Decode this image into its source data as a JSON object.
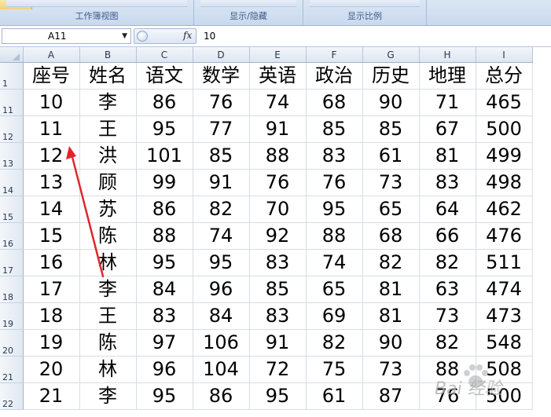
{
  "ribbon": {
    "groups": [
      {
        "label": "工作簿视图"
      },
      {
        "label": "显示/隐藏"
      },
      {
        "label": "显示比例"
      }
    ]
  },
  "formula_bar": {
    "name_box": "A11",
    "fx_icon": "fx",
    "value": "10"
  },
  "grid": {
    "columns": [
      "A",
      "B",
      "C",
      "D",
      "E",
      "F",
      "G",
      "H",
      "I"
    ],
    "header_row": {
      "row": "1",
      "cells": [
        "座号",
        "姓名",
        "语文",
        "数学",
        "英语",
        "政治",
        "历史",
        "地理",
        "总分"
      ]
    },
    "rows": [
      {
        "row": "11",
        "cells": [
          "10",
          "李",
          "86",
          "76",
          "74",
          "68",
          "90",
          "71",
          "465"
        ]
      },
      {
        "row": "12",
        "cells": [
          "11",
          "王",
          "95",
          "77",
          "91",
          "85",
          "85",
          "67",
          "500"
        ]
      },
      {
        "row": "13",
        "cells": [
          "12",
          "洪",
          "101",
          "85",
          "88",
          "83",
          "61",
          "81",
          "499"
        ]
      },
      {
        "row": "14",
        "cells": [
          "13",
          "顾",
          "99",
          "91",
          "76",
          "76",
          "73",
          "83",
          "498"
        ]
      },
      {
        "row": "15",
        "cells": [
          "14",
          "苏",
          "86",
          "82",
          "70",
          "95",
          "65",
          "64",
          "462"
        ]
      },
      {
        "row": "16",
        "cells": [
          "15",
          "陈",
          "88",
          "74",
          "92",
          "88",
          "68",
          "66",
          "476"
        ]
      },
      {
        "row": "17",
        "cells": [
          "16",
          "林",
          "95",
          "95",
          "83",
          "74",
          "82",
          "82",
          "511"
        ]
      },
      {
        "row": "18",
        "cells": [
          "17",
          "李",
          "84",
          "96",
          "85",
          "65",
          "81",
          "63",
          "474"
        ]
      },
      {
        "row": "19",
        "cells": [
          "18",
          "王",
          "83",
          "84",
          "83",
          "69",
          "81",
          "73",
          "473"
        ]
      },
      {
        "row": "20",
        "cells": [
          "19",
          "陈",
          "97",
          "106",
          "91",
          "82",
          "90",
          "82",
          "548"
        ]
      },
      {
        "row": "21",
        "cells": [
          "20",
          "林",
          "96",
          "104",
          "72",
          "75",
          "73",
          "88",
          "508"
        ]
      },
      {
        "row": "22",
        "cells": [
          "21",
          "李",
          "95",
          "86",
          "95",
          "61",
          "87",
          "76",
          "500"
        ]
      }
    ]
  },
  "annotation": {
    "arrow_color": "#e0262b"
  },
  "watermark": {
    "text": "Bai 经验"
  }
}
